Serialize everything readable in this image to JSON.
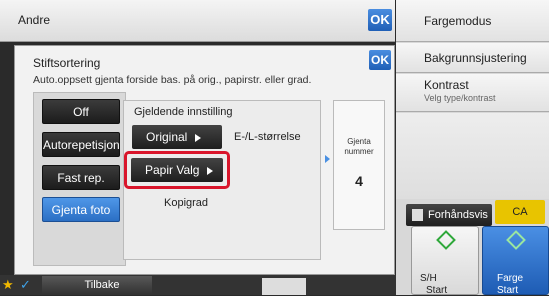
{
  "topbar": {
    "title": "Andre",
    "ok": "OK"
  },
  "dialog": {
    "title": "Stiftsortering",
    "subtitle": "Auto.oppsett gjenta forside bas. på orig., papirstr. eller grad.",
    "ok": "OK",
    "modes": [
      {
        "label": "Off",
        "selected": false
      },
      {
        "label": "Autorepetisjon",
        "selected": false
      },
      {
        "label": "Fast rep.",
        "selected": false
      },
      {
        "label": "Gjenta foto",
        "selected": true
      }
    ],
    "current_setting": "Gjeldende innstilling",
    "original_label": "Original",
    "original_value": "E-/L-størrelse",
    "paper_label": "Papir Valg",
    "copy_level": "Kopigrad",
    "repeat_label": "Gjenta nummer",
    "repeat_value": "4"
  },
  "right_panel": {
    "items": [
      "Fargemodus",
      "Bakgrunnsjustering",
      "Kontrast"
    ],
    "contrast_sub": "Velg type/kontrast",
    "preview": "Forhåndsvis",
    "ca": "CA",
    "start_bw": "S/H",
    "start_bw_sub": "Start",
    "start_color": "Farge",
    "start_color_sub": "Start"
  },
  "bottom": {
    "back": "Tilbake"
  },
  "colors": {
    "accent": "#1f5fb6",
    "highlight": "#d9152b",
    "ca": "#e8c400"
  }
}
